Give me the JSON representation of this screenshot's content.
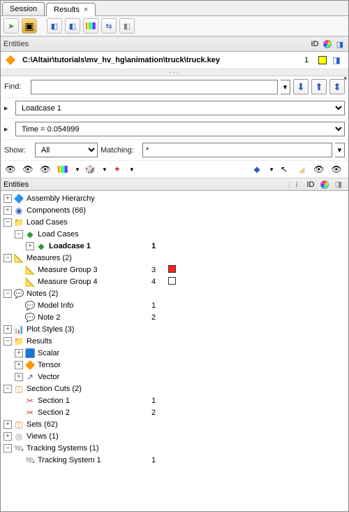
{
  "tabs": {
    "session": "Session",
    "results": "Results"
  },
  "entities_panel": {
    "title": "Entities",
    "id_hdr": "ID"
  },
  "file": {
    "path": "C:\\Altair\\tutorials\\mv_hv_hg\\animation\\truck\\truck.key",
    "id": "1"
  },
  "find": {
    "label": "Find:",
    "value": ""
  },
  "loadcase_select": "Loadcase 1",
  "time_select": "Time = 0.054999",
  "show": {
    "label": "Show:",
    "value": "All"
  },
  "matching": {
    "label": "Matching:",
    "value": "*"
  },
  "tree_hdr": {
    "entities": "Entities",
    "id": "ID"
  },
  "tree": {
    "assembly": "Assembly Hierarchy",
    "components": "Components (66)",
    "loadcases_root": "Load Cases",
    "loadcases_child": "Load Cases",
    "loadcase1": "Loadcase 1",
    "loadcase1_id": "1",
    "measures": "Measures (2)",
    "mg3": "Measure Group 3",
    "mg3_id": "3",
    "mg4": "Measure Group 4",
    "mg4_id": "4",
    "notes": "Notes (2)",
    "modelinfo": "Model Info",
    "modelinfo_id": "1",
    "note2": "Note 2",
    "note2_id": "2",
    "plotstyles": "Plot Styles (3)",
    "results": "Results",
    "scalar": "Scalar",
    "tensor": "Tensor",
    "vector": "Vector",
    "seccuts": "Section Cuts (2)",
    "sec1": "Section 1",
    "sec1_id": "1",
    "sec2": "Section 2",
    "sec2_id": "2",
    "sets": "Sets  (62)",
    "views": "Views (1)",
    "tracking": "Tracking Systems (1)",
    "track1": "Tracking System 1",
    "track1_id": "1"
  }
}
